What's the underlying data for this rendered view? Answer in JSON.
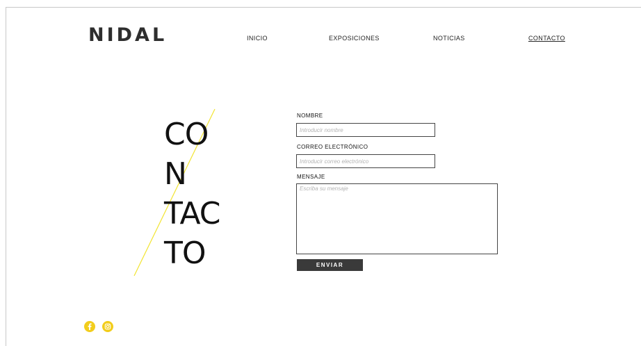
{
  "brand": {
    "logo_text": "NIDAL"
  },
  "nav": {
    "items": [
      {
        "label": "INICIO",
        "active": false
      },
      {
        "label": "EXPOSICIONES",
        "active": false
      },
      {
        "label": "NOTICIAS",
        "active": false
      },
      {
        "label": "CONTACTO",
        "active": true
      }
    ]
  },
  "hero": {
    "lines": [
      "CO",
      "N",
      "TAC",
      "TO"
    ],
    "accent_color": "#f2e430"
  },
  "form": {
    "name": {
      "label": "NOMBRE",
      "placeholder": "Introducir nombre",
      "value": ""
    },
    "email": {
      "label": "CORREO ELECTRÓNICO",
      "placeholder": "Introducir correo electrónico",
      "value": ""
    },
    "message": {
      "label": "MENSAJE",
      "placeholder": "Escriba su mensaje",
      "value": ""
    },
    "submit_label": "ENVIAR"
  },
  "social": {
    "icons": [
      "facebook-icon",
      "instagram-icon"
    ],
    "color": "#f2cd1c"
  }
}
